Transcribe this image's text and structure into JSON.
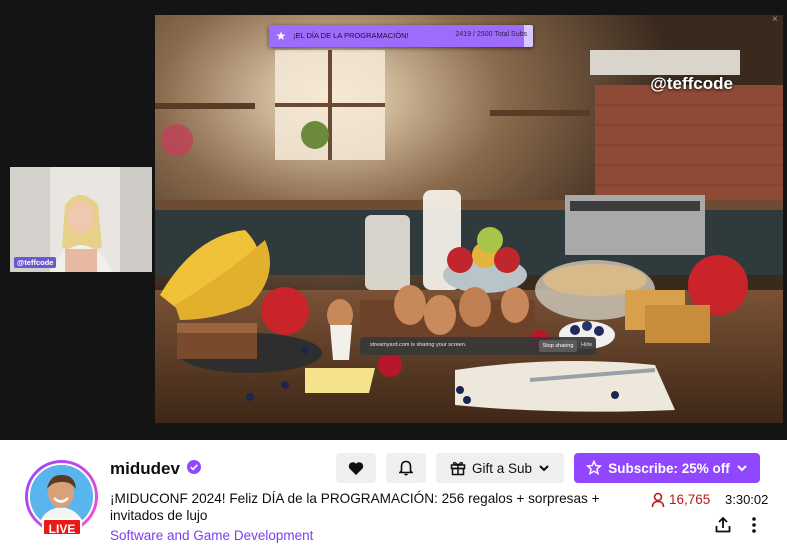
{
  "stream": {
    "progress": {
      "title": "¡EL DÍA DE LA PROGRAMACIÓN!",
      "count_text": "2419 / 2500 Total Subs",
      "fraction": 0.9676
    },
    "overlay_handle": "@teffcode",
    "webcam_tag": "@teffcode",
    "share_banner": {
      "text": "streamyard.com is sharing your screen.",
      "stop_label": "Stop sharing",
      "hide_label": "Hide"
    },
    "close_label": "×"
  },
  "channel": {
    "name": "midudev",
    "live_label": "LIVE",
    "title": "¡MIDUCONF 2024! Feliz DÍA de la PROGRAMACIÓN: 256 regalos + sorpresas + invitados de lujo",
    "category": "Software and Game Development",
    "viewers": "16,765",
    "uptime": "3:30:02"
  },
  "actions": {
    "gift_label": "Gift a Sub",
    "subscribe_label": "Subscribe: 25% off"
  },
  "icons": {
    "heart": "heart-icon",
    "bell": "bell-icon",
    "gift": "gift-icon",
    "star": "star-icon",
    "chevron": "chevron-down-icon",
    "verified": "verified-icon",
    "viewers": "person-icon",
    "share": "share-icon",
    "more": "more-vertical-icon"
  },
  "colors": {
    "accent": "#9147ff",
    "live": "#e91916",
    "category": "#7a3ff2",
    "viewers": "#b91c1c"
  }
}
